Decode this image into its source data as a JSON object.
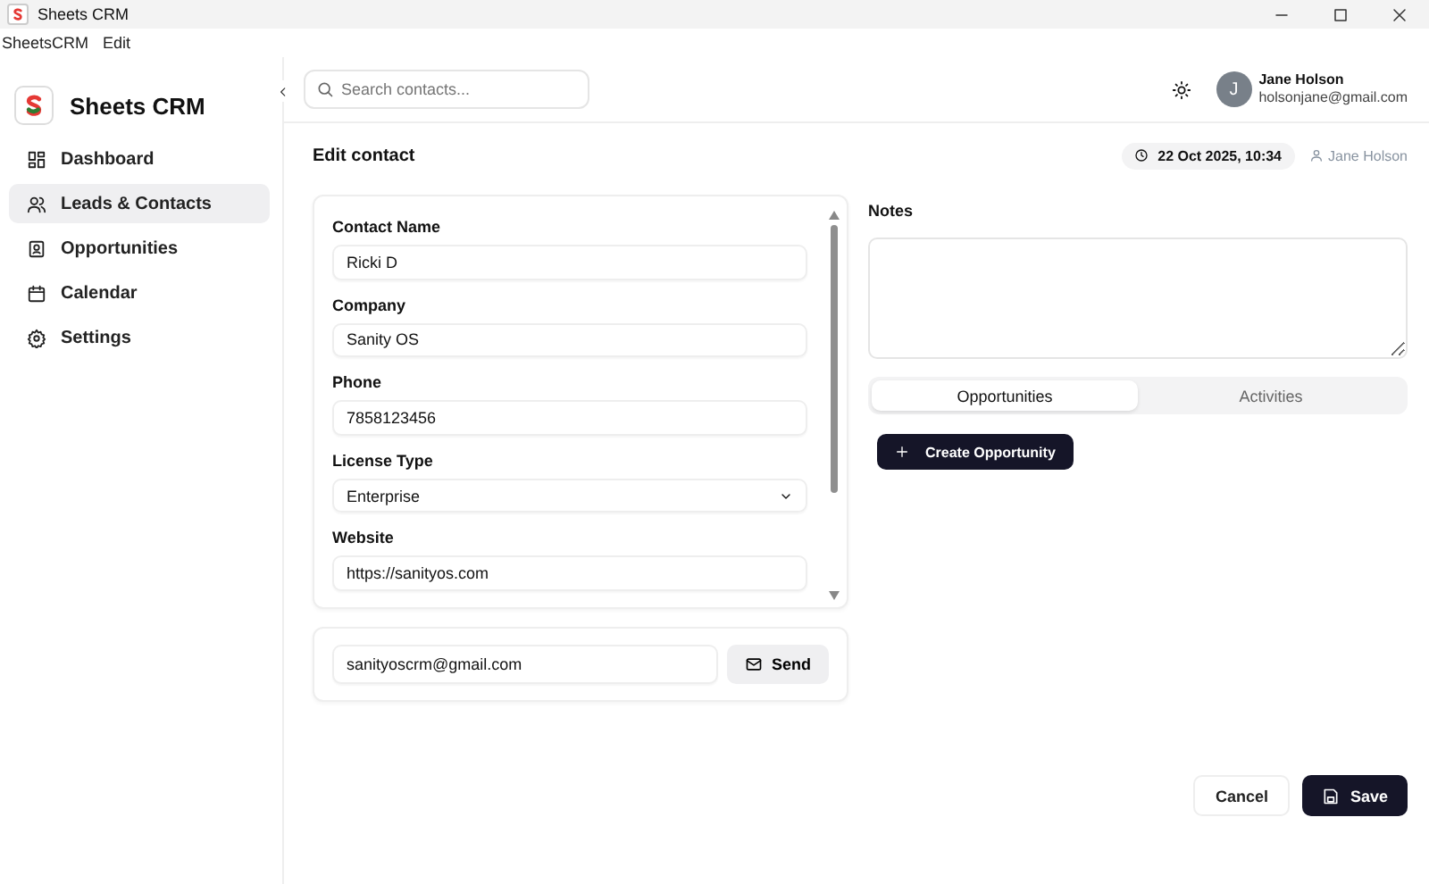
{
  "window": {
    "title": "Sheets CRM"
  },
  "menu": [
    "SheetsCRM",
    "Edit"
  ],
  "sidebar": {
    "app_name": "Sheets CRM",
    "items": [
      {
        "label": "Dashboard",
        "selected": false
      },
      {
        "label": "Leads & Contacts",
        "selected": true
      },
      {
        "label": "Opportunities",
        "selected": false
      },
      {
        "label": "Calendar",
        "selected": false
      },
      {
        "label": "Settings",
        "selected": false
      }
    ]
  },
  "header": {
    "search": {
      "placeholder": "Search contacts..."
    },
    "user": {
      "initial": "J",
      "name": "Jane Holson",
      "email": "holsonjane@gmail.com"
    }
  },
  "page": {
    "title": "Edit contact",
    "timestamp": "22 Oct 2025, 10:34",
    "owner": "Jane Holson"
  },
  "form": {
    "fields": [
      {
        "label": "Contact Name",
        "kind": "text",
        "value": "Ricki D"
      },
      {
        "label": "Company",
        "kind": "text",
        "value": "Sanity OS"
      },
      {
        "label": "Phone",
        "kind": "text",
        "value": "7858123456"
      },
      {
        "label": "License Type",
        "kind": "select",
        "value": "Enterprise"
      },
      {
        "label": "Website",
        "kind": "text",
        "value": "https://sanityos.com"
      }
    ]
  },
  "email": {
    "value": "sanityoscrm@gmail.com",
    "button": "Send"
  },
  "notes": {
    "label": "Notes"
  },
  "tabs": [
    {
      "label": "Opportunities",
      "selected": true
    },
    {
      "label": "Activities",
      "selected": false
    }
  ],
  "create_button": "Create Opportunity",
  "actions": [
    {
      "label": "Cancel",
      "kind": "secondary"
    },
    {
      "label": "Save",
      "kind": "primary"
    }
  ]
}
